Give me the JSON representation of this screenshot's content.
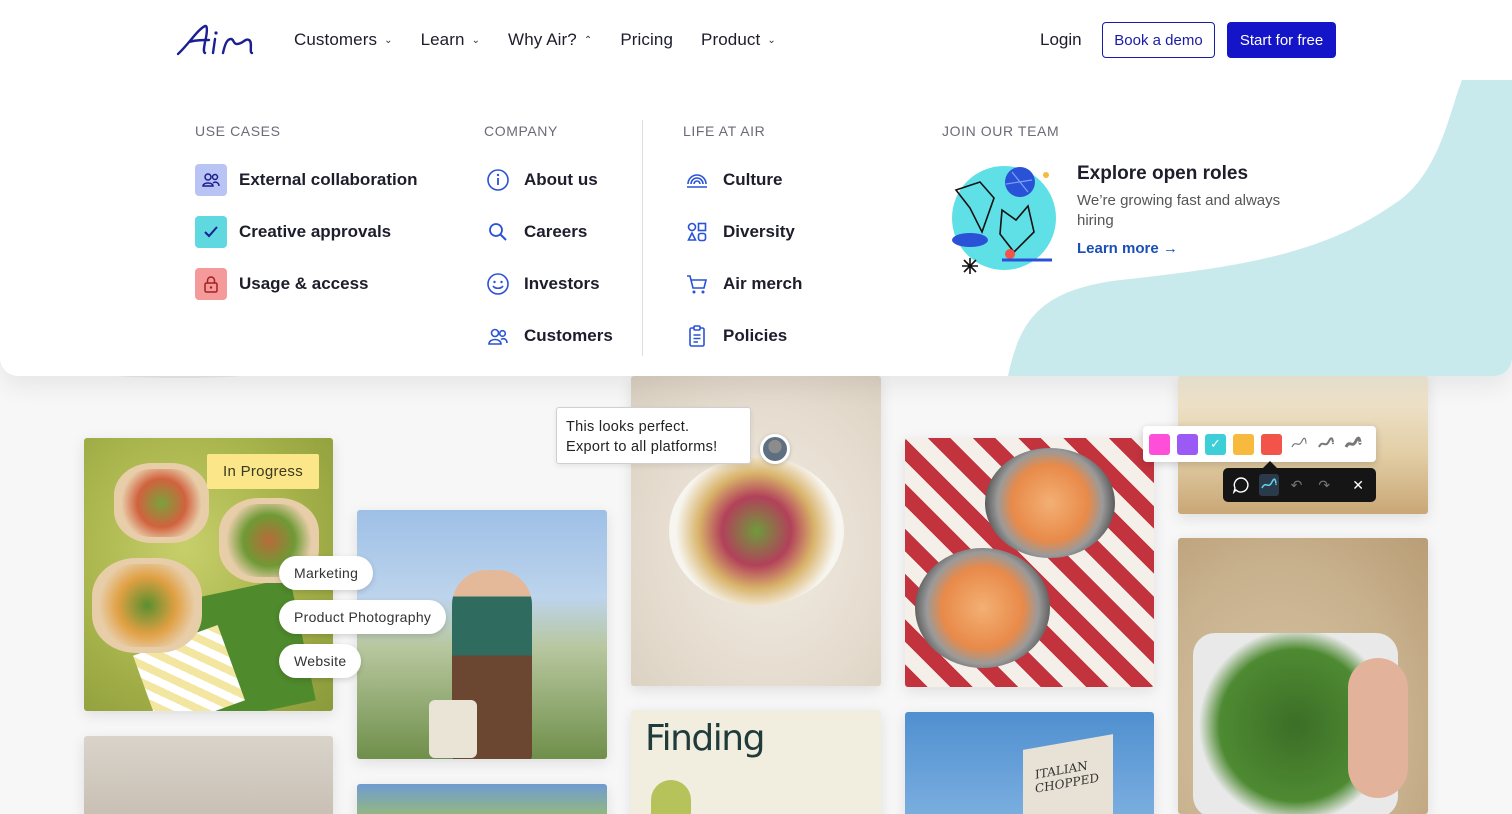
{
  "header": {
    "logo_text": "Air",
    "nav": [
      {
        "label": "Customers",
        "chevron": "v"
      },
      {
        "label": "Learn",
        "chevron": "v"
      },
      {
        "label": "Why Air?",
        "chevron": "^"
      },
      {
        "label": "Pricing",
        "chevron": ""
      },
      {
        "label": "Product",
        "chevron": "v"
      }
    ],
    "login": "Login",
    "book_demo": "Book a demo",
    "start_free": "Start for free"
  },
  "menu": {
    "use_cases": {
      "title": "USE CASES",
      "items": [
        {
          "label": "External collaboration",
          "icon": "people-icon",
          "color": "#b9c4f5"
        },
        {
          "label": "Creative approvals",
          "icon": "check-icon",
          "color": "#5fd8e0"
        },
        {
          "label": "Usage & access",
          "icon": "lock-icon",
          "color": "#f49a9a"
        }
      ]
    },
    "company": {
      "title": "COMPANY",
      "items": [
        {
          "label": "About us",
          "icon": "info-icon"
        },
        {
          "label": "Careers",
          "icon": "search-icon"
        },
        {
          "label": "Investors",
          "icon": "smiley-icon"
        },
        {
          "label": "Customers",
          "icon": "people-icon"
        }
      ]
    },
    "life": {
      "title": "LIFE AT AIR",
      "items": [
        {
          "label": "Culture",
          "icon": "rainbow-icon"
        },
        {
          "label": "Diversity",
          "icon": "shapes-icon"
        },
        {
          "label": "Air merch",
          "icon": "cart-icon"
        },
        {
          "label": "Policies",
          "icon": "clipboard-icon"
        }
      ]
    },
    "join": {
      "title": "JOIN OUR TEAM",
      "roles_title": "Explore open roles",
      "roles_sub": "We’re growing fast and always hiring",
      "roles_link": "Learn more →"
    }
  },
  "gallery": {
    "status_badge": "In Progress",
    "tags": [
      "Marketing",
      "Product Photography",
      "Website"
    ],
    "comment": {
      "line1": "This looks perfect.",
      "line2": "Export to all platforms!"
    },
    "poster_text": "Finding",
    "billboard_text": "ITALIAN CHOPPED",
    "palette": [
      "#ff4fd8",
      "#9b59f5",
      "#3ccfd8",
      "#f7b93e",
      "#f2544a"
    ],
    "accent_blue": "#1414c8",
    "blob_color": "#c9eaec"
  }
}
